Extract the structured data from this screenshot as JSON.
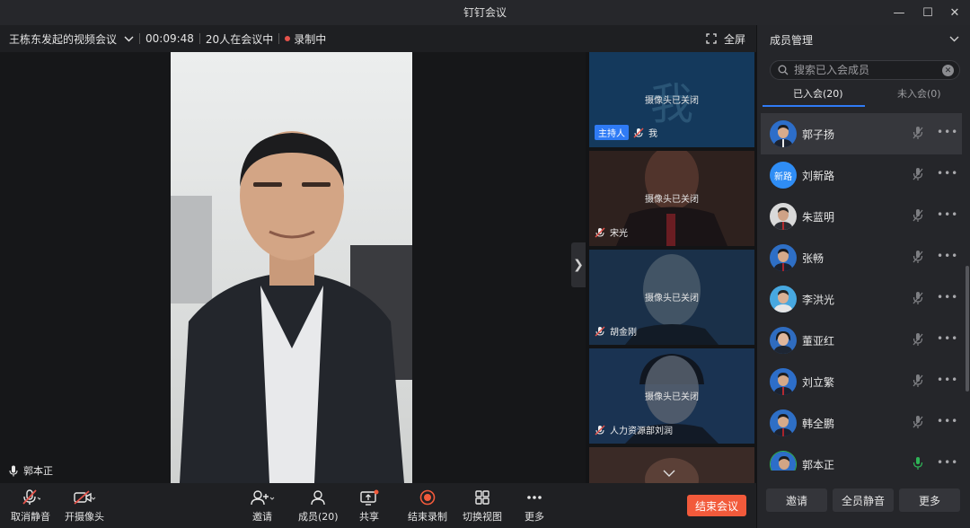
{
  "window": {
    "title": "钉钉会议"
  },
  "meeting": {
    "name": "王栋东发起的视频会议",
    "duration": "00:09:48",
    "attendance": "20人在会议中",
    "recording": "录制中",
    "fullscreen_label": "全屏"
  },
  "stage": {
    "speaker_name": "郭本正"
  },
  "thumbnails": [
    {
      "name": "我",
      "host_badge": "主持人",
      "camera_status": "摄像头已关闭",
      "big_text": "我"
    },
    {
      "name": "宋光",
      "camera_status": "摄像头已关闭"
    },
    {
      "name": "胡金刚",
      "camera_status": "摄像头已关闭"
    },
    {
      "name": "人力资源部刘润",
      "camera_status": "摄像头已关闭"
    }
  ],
  "toolbar": {
    "unmute": "取消静音",
    "camera": "开摄像头",
    "invite": "邀请",
    "members": "成员(20)",
    "share": "共享",
    "stop_recording": "结束录制",
    "switch_view": "切换视图",
    "more": "更多",
    "end_meeting": "结束会议"
  },
  "panel": {
    "title": "成员管理",
    "search_placeholder": "搜索已入会成员",
    "tabs": [
      {
        "label": "已入会(20)",
        "active": true
      },
      {
        "label": "未入会(0)",
        "active": false
      }
    ],
    "members": [
      {
        "name": "郭子扬",
        "avatar": "photo",
        "mic": "muted"
      },
      {
        "name": "刘新路",
        "avatar": "text",
        "avatar_text": "新路",
        "mic": "muted"
      },
      {
        "name": "朱蓝明",
        "avatar": "photo",
        "mic": "muted"
      },
      {
        "name": "张畅",
        "avatar": "photo",
        "mic": "muted"
      },
      {
        "name": "李洪光",
        "avatar": "photo",
        "mic": "muted"
      },
      {
        "name": "董亚红",
        "avatar": "photo",
        "mic": "muted"
      },
      {
        "name": "刘立繁",
        "avatar": "photo",
        "mic": "muted"
      },
      {
        "name": "韩全鹏",
        "avatar": "photo",
        "mic": "muted"
      },
      {
        "name": "郭本正",
        "avatar": "photo",
        "mic": "speaking"
      }
    ],
    "actions": {
      "invite": "邀请",
      "mute_all": "全员静音",
      "more": "更多"
    }
  },
  "colors": {
    "accent": "#2f7bf5",
    "danger": "#f25a3b",
    "speaking": "#2fb457"
  }
}
